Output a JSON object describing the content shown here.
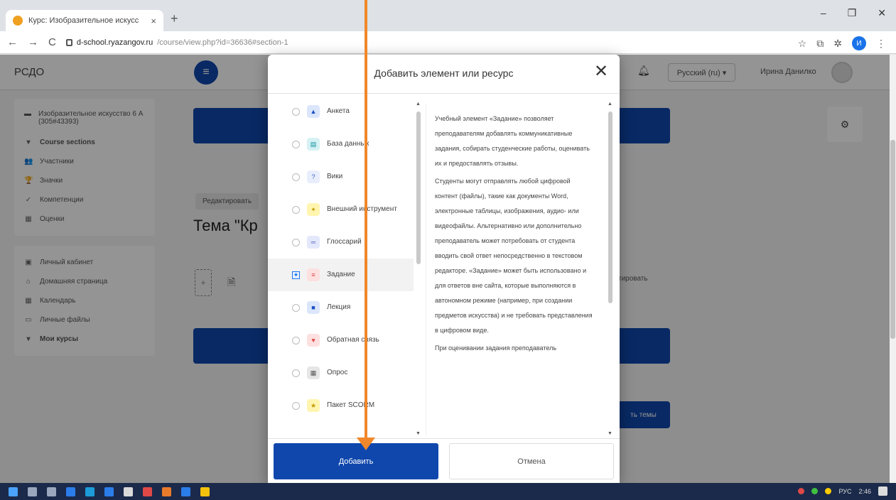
{
  "browser": {
    "tab_title": "Курс: Изобразительное искусс",
    "tab_close": "×",
    "new_tab": "+",
    "url_host": "d-school.ryazangov.ru",
    "url_path": "/course/view.php?id=36636#section-1",
    "back": "←",
    "forward": "→",
    "reload": "C",
    "star": "☆",
    "profile_initial": "И",
    "menu_dots": "⋮",
    "window_controls": [
      "–",
      "❐",
      "✕"
    ]
  },
  "site": {
    "brand": "РСДО",
    "menu_icon": "≡",
    "bell_icon": "bell-icon",
    "language": "Русский (ru) ▾",
    "user_name": "Ирина Данилко"
  },
  "sidebar": {
    "course_name": "Изобразительное искусство 6 А (305#43393)",
    "items": [
      {
        "icon": "▾",
        "label": "Course sections",
        "bold": true
      },
      {
        "icon": "👥",
        "label": "Участники"
      },
      {
        "icon": "🏆",
        "label": "Значки"
      },
      {
        "icon": "✓",
        "label": "Компетенции"
      },
      {
        "icon": "▦",
        "label": "Оценки"
      }
    ],
    "items2": [
      {
        "icon": "▣",
        "label": "Личный кабинет"
      },
      {
        "icon": "⌂",
        "label": "Домашняя страница"
      },
      {
        "icon": "▦",
        "label": "Календарь"
      },
      {
        "icon": "▭",
        "label": "Личные файлы"
      },
      {
        "icon": "▾",
        "label": "Мои курсы",
        "bold": true
      }
    ]
  },
  "main": {
    "edit_chip": "Редактировать",
    "topic_title": "Тема \"Кр",
    "side_button_partial": "ть темы",
    "right_fragment": "тировать"
  },
  "modal": {
    "title": "Добавить элемент или ресурс",
    "close": "✕",
    "items": [
      {
        "label": "Анкета",
        "icon_bg": "#dbe6fb",
        "icon": "▲",
        "icon_color": "#1a4fc4",
        "selected": false
      },
      {
        "label": "База данных",
        "icon_bg": "#d6f1f3",
        "icon": "▤",
        "icon_color": "#0a8fa0",
        "selected": false
      },
      {
        "label": "Вики",
        "icon_bg": "#e8eefc",
        "icon": "?",
        "icon_color": "#3a5fcf",
        "selected": false
      },
      {
        "label": "Внешний инструмент",
        "icon_bg": "#fff5b0",
        "icon": "✦",
        "icon_color": "#c29a00",
        "selected": false
      },
      {
        "label": "Глоссарий",
        "icon_bg": "#e3e8fb",
        "icon": "═",
        "icon_color": "#5566cc",
        "selected": false
      },
      {
        "label": "Задание",
        "icon_bg": "#fde0e0",
        "icon": "≡",
        "icon_color": "#e04848",
        "selected": true
      },
      {
        "label": "Лекция",
        "icon_bg": "#dbe6fb",
        "icon": "■",
        "icon_color": "#1a4fc4",
        "selected": false
      },
      {
        "label": "Обратная связь",
        "icon_bg": "#fde0e0",
        "icon": "♥",
        "icon_color": "#e04848",
        "selected": false
      },
      {
        "label": "Опрос",
        "icon_bg": "#e6e6e6",
        "icon": "▦",
        "icon_color": "#555555",
        "selected": false
      },
      {
        "label": "Пакет SCORM",
        "icon_bg": "#fff5b0",
        "icon": "★",
        "icon_color": "#c29a00",
        "selected": false
      }
    ],
    "description": [
      "Учебный элемент «Задание» позволяет преподавателям добавлять коммуникативные задания, собирать студенческие работы, оценивать их и предоставлять отзывы.",
      "Студенты могут отправлять любой цифровой контент (файлы), такие как документы Word, электронные таблицы, изображения, аудио- или видеофайлы. Альтернативно или дополнительно преподаватель может потребовать от студента вводить свой ответ непосредственно в текстовом редакторе. «Задание» может быть использовано и для ответов вне сайта, которые выполняются в автономном режиме (например, при создании предметов искусства) и не требовать представления в цифровом виде.",
      "При оценивании задания преподаватель"
    ],
    "add_button": "Добавить",
    "cancel_button": "Отмена"
  },
  "taskbar": {
    "tray_text": "РУС",
    "time": "2:46"
  },
  "colors": {
    "primary": "#0f47ad",
    "annotation_arrow": "#f0872a"
  }
}
